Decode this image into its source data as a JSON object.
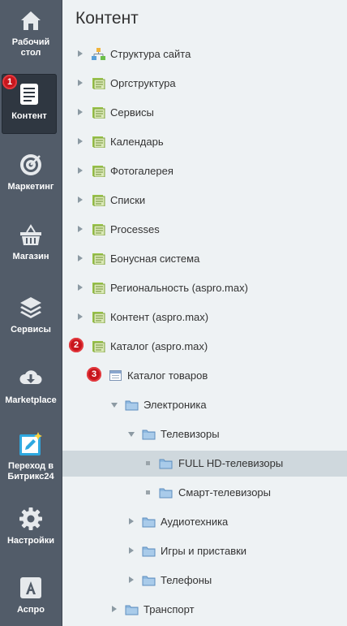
{
  "page": {
    "title": "Контент"
  },
  "sidebar": {
    "items": [
      {
        "label_line1": "Рабочий",
        "label_line2": "стол"
      },
      {
        "label_line1": "Контент",
        "label_line2": ""
      },
      {
        "label_line1": "Маркетинг",
        "label_line2": ""
      },
      {
        "label_line1": "Магазин",
        "label_line2": ""
      },
      {
        "label_line1": "Сервисы",
        "label_line2": ""
      },
      {
        "label_line1": "Marketplace",
        "label_line2": ""
      },
      {
        "label_line1": "Переход в",
        "label_line2": "Битрикс24"
      },
      {
        "label_line1": "Настройки",
        "label_line2": ""
      },
      {
        "label_line1": "Аспро",
        "label_line2": ""
      }
    ]
  },
  "markers": [
    "1",
    "2",
    "3"
  ],
  "tree": [
    {
      "label": "Структура сайта"
    },
    {
      "label": "Оргструктура"
    },
    {
      "label": "Сервисы"
    },
    {
      "label": "Календарь"
    },
    {
      "label": "Фотогалерея"
    },
    {
      "label": "Списки"
    },
    {
      "label": "Processes"
    },
    {
      "label": "Бонусная система"
    },
    {
      "label": "Региональность (aspro.max)"
    },
    {
      "label": "Контент (aspro.max)"
    },
    {
      "label": "Каталог (aspro.max)"
    },
    {
      "label": "Каталог товаров"
    },
    {
      "label": "Электроника"
    },
    {
      "label": "Телевизоры"
    },
    {
      "label": "FULL HD-телевизоры"
    },
    {
      "label": "Смарт-телевизоры"
    },
    {
      "label": "Аудиотехника"
    },
    {
      "label": "Игры и приставки"
    },
    {
      "label": "Телефоны"
    },
    {
      "label": "Транспорт"
    }
  ],
  "colors": {
    "sidebar_bg": "#525c69",
    "marker_red": "#c8161d",
    "selected_row": "#cfd8dd",
    "folder_blue": "#8fb9e0",
    "list_green": "#9bc64b"
  }
}
